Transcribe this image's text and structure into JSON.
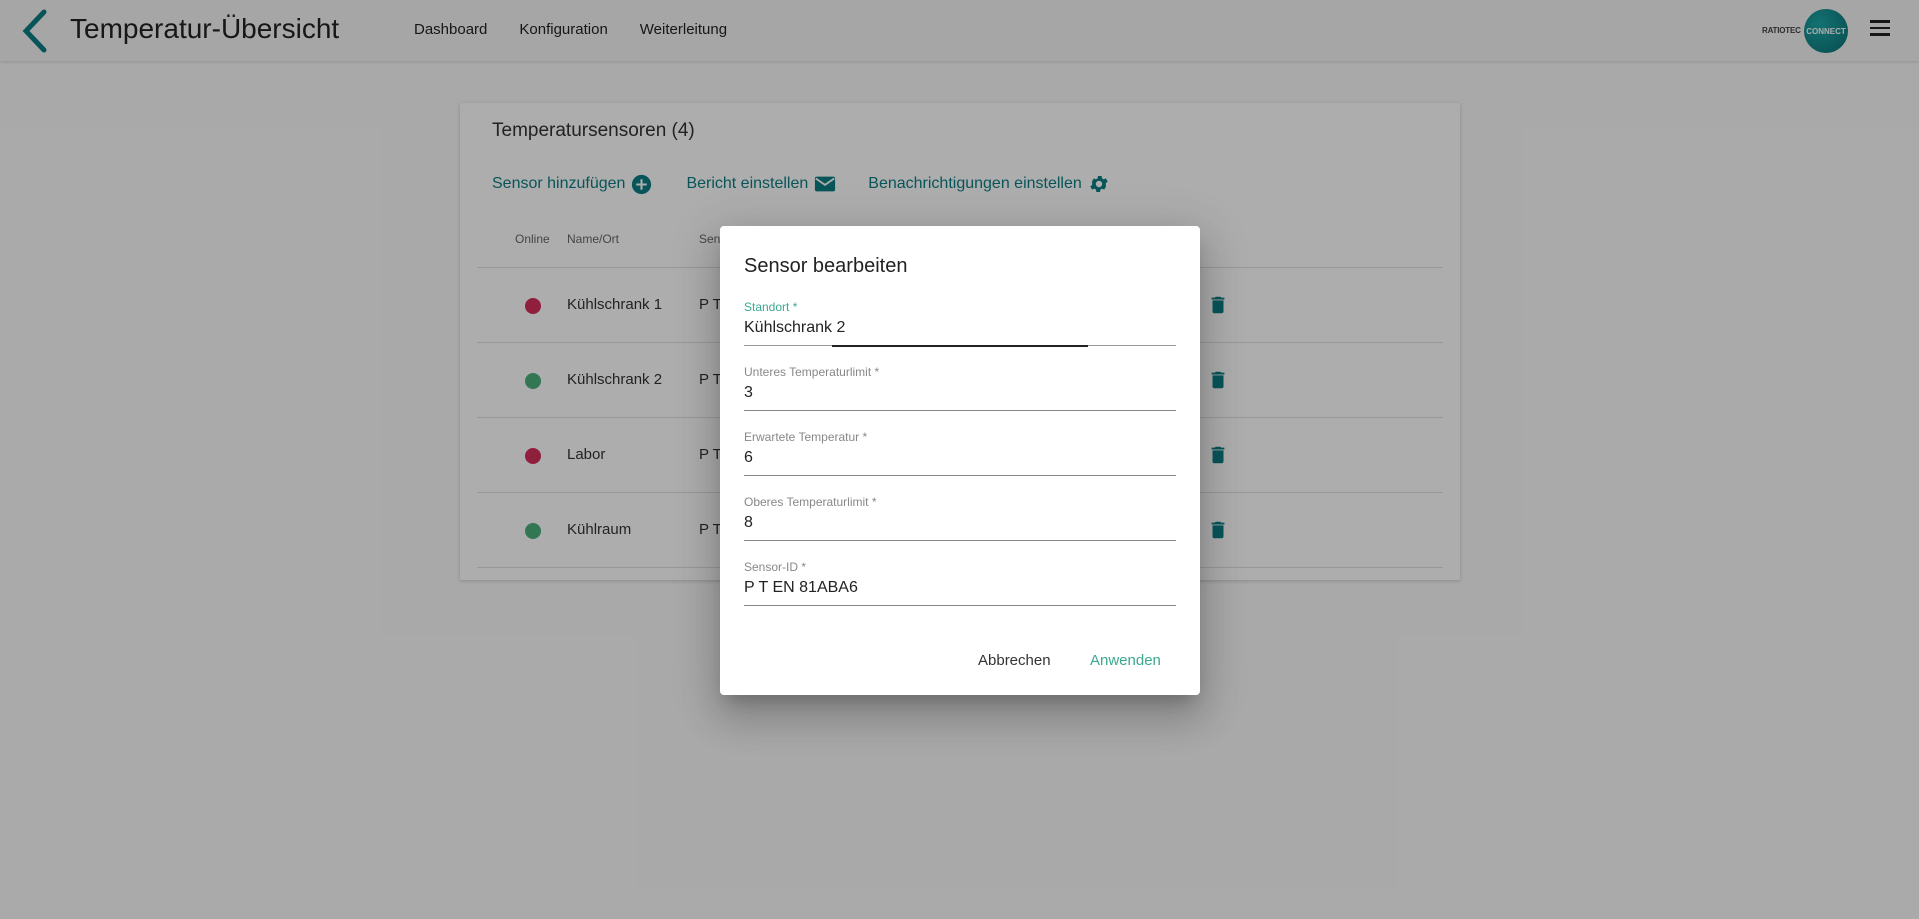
{
  "header": {
    "title": "Temperatur-Übersicht",
    "nav": [
      "Dashboard",
      "Konfiguration",
      "Weiterleitung"
    ],
    "brand": {
      "left_text": "RATIOTEC",
      "circle_text": "CONNECT"
    },
    "accent_color": "#0d7e83"
  },
  "card": {
    "title": "Temperatursensoren (4)",
    "actions": [
      {
        "label": "Sensor hinzufügen",
        "icon": "add-circle-icon"
      },
      {
        "label": "Bericht einstellen",
        "icon": "envelope-icon"
      },
      {
        "label": "Benachrichtigungen einstellen",
        "icon": "gear-icon"
      }
    ],
    "columns": {
      "online": "Online",
      "name": "Name/Ort",
      "sensor_partial": "Sen"
    },
    "rows": [
      {
        "online": false,
        "name": "Kühlschrank 1",
        "sensor_partial": "P T"
      },
      {
        "online": true,
        "name": "Kühlschrank 2",
        "sensor_partial": "P T"
      },
      {
        "online": false,
        "name": "Labor",
        "sensor_partial": "P T"
      },
      {
        "online": true,
        "name": "Kühlraum",
        "sensor_partial": "P T"
      }
    ],
    "status_colors": {
      "offline": "#d32f5a",
      "online": "#4caf7d"
    }
  },
  "dialog": {
    "title": "Sensor bearbeiten",
    "fields": [
      {
        "label": "Standort *",
        "value": "Kühlschrank 2"
      },
      {
        "label": "Unteres Temperaturlimit *",
        "value": "3"
      },
      {
        "label": "Erwartete Temperatur *",
        "value": "6"
      },
      {
        "label": "Oberes Temperaturlimit *",
        "value": "8"
      },
      {
        "label": "Sensor-ID *",
        "value": "P T EN 81ABA6"
      }
    ],
    "cancel_label": "Abbrechen",
    "apply_label": "Anwenden",
    "active_label_color": "#3aa890"
  }
}
